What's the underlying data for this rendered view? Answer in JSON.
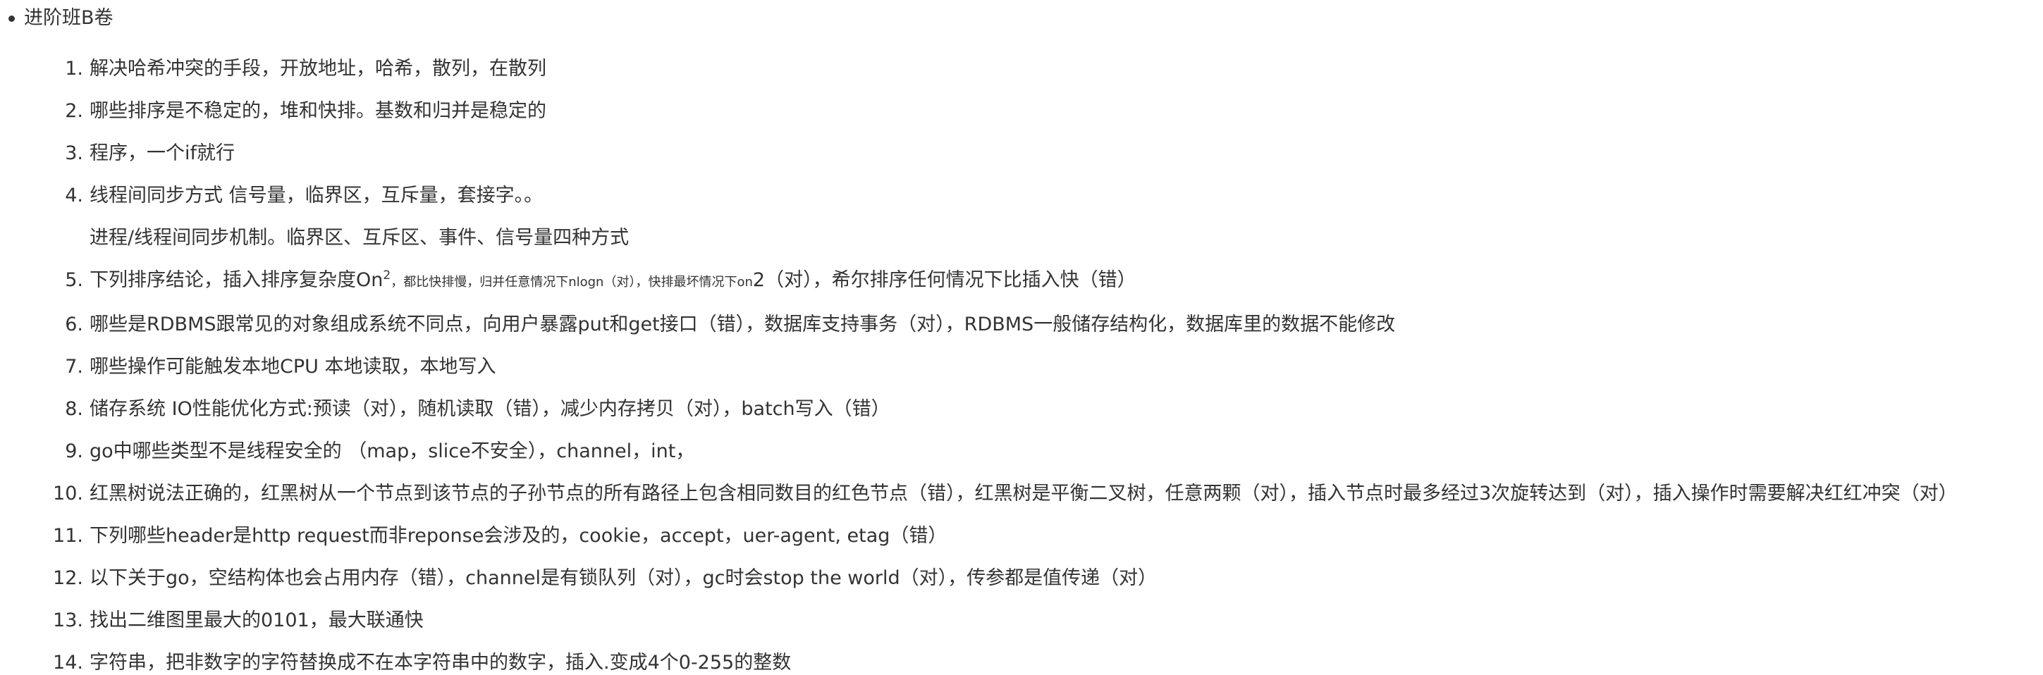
{
  "document": {
    "section_title": "进阶班B卷",
    "items": [
      {
        "number": "1.",
        "line1": "解决哈希冲突的手段，开放地址，哈希，散列，在散列"
      },
      {
        "number": "2.",
        "line1": "哪些排序是不稳定的，堆和快排。基数和归并是稳定的"
      },
      {
        "number": "3.",
        "line1": "程序，一个if就行"
      },
      {
        "number": "4.",
        "line1": "线程间同步方式 信号量，临界区，互斥量，套接字。。",
        "line2": "进程/线程间同步机制。临界区、互斥区、事件、信号量四种方式"
      },
      {
        "number": "5.",
        "part1": "下列排序结论，插入排序复杂度On",
        "sup": "2",
        "small1": "，都比快排慢，归并任意情况下nlogn（对），快排最坏情况下on",
        "part2": "2（对），希尔排序任何情况下比插入快（错）"
      },
      {
        "number": "6.",
        "line1": "哪些是RDBMS跟常见的对象组成系统不同点，向用户暴露put和get接口（错），数据库支持事务（对），RDBMS一般储存结构化，数据库里的数据不能修改"
      },
      {
        "number": "7.",
        "line1": "哪些操作可能触发本地CPU 本地读取，本地写入"
      },
      {
        "number": "8.",
        "line1": "储存系统 IO性能优化方式:预读（对），随机读取（错），减少内存拷贝（对），batch写入（错）"
      },
      {
        "number": "9.",
        "line1": "go中哪些类型不是线程安全的 （map，slice不安全），channel，int，"
      },
      {
        "number": "10.",
        "line1": "红黑树说法正确的，红黑树从一个节点到该节点的子孙节点的所有路径上包含相同数目的红色节点（错），红黑树是平衡二叉树，任意两颗（对），插入节点时最多经过3次旋转达到（对），插入操作时需要解决红红冲突（对）"
      },
      {
        "number": "11.",
        "line1": "下列哪些header是http request而非reponse会涉及的，cookie，accept，uer-agent, etag（错）"
      },
      {
        "number": "12.",
        "line1": "以下关于go，空结构体也会占用内存（错），channel是有锁队列（对），gc时会stop the world（对），传参都是值传递（对）"
      },
      {
        "number": "13.",
        "line1": "找出二维图里最大的0101，最大联通快"
      },
      {
        "number": "14.",
        "line1": "字符串，把非数字的字符替换成不在本字符串中的数字，插入.变成4个0-255的整数"
      }
    ]
  }
}
